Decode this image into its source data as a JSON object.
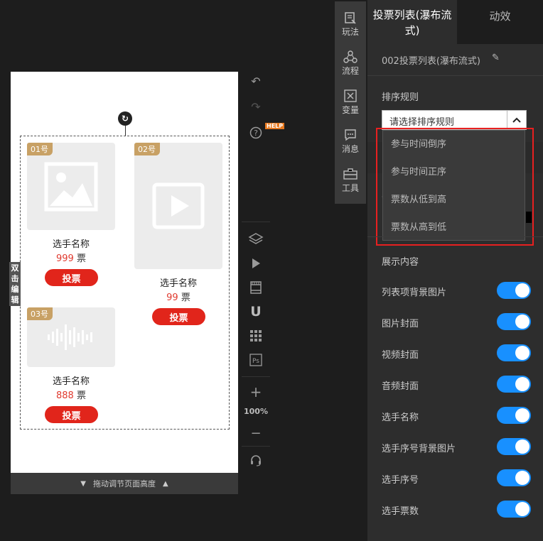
{
  "canvas": {
    "double_click_edit": "双击编辑",
    "footer_label": "拖动调节页面高度",
    "players": [
      {
        "badge": "01号",
        "name": "选手名称",
        "votes": "999",
        "unit": "票",
        "button": "投票",
        "media": "image"
      },
      {
        "badge": "02号",
        "name": "选手名称",
        "votes": "99",
        "unit": "票",
        "button": "投票",
        "media": "video"
      },
      {
        "badge": "03号",
        "name": "选手名称",
        "votes": "888",
        "unit": "票",
        "button": "投票",
        "media": "audio"
      }
    ]
  },
  "toolbar": {
    "help_tag": "HELP",
    "zoom": "100%",
    "icons": [
      "undo-icon",
      "redo-icon",
      "help-icon",
      "layers-icon",
      "play-icon",
      "film-icon",
      "magnet-icon",
      "grid-icon",
      "ps-icon",
      "zoom-in-icon",
      "zoom-out-icon",
      "headset-icon"
    ]
  },
  "side_tools": [
    {
      "label": "玩法",
      "icon": "gameplay-icon"
    },
    {
      "label": "流程",
      "icon": "flow-icon"
    },
    {
      "label": "变量",
      "icon": "variable-icon"
    },
    {
      "label": "消息",
      "icon": "message-icon"
    },
    {
      "label": "工具",
      "icon": "toolbox-icon"
    }
  ],
  "panel": {
    "tab_active": "投票列表(瀑布流式)",
    "tab_inactive": "动效",
    "component_title": "002投票列表(瀑布流式)",
    "sort_label": "排序规则",
    "sort_placeholder": "请选择排序规则",
    "sort_options": [
      "参与时间倒序",
      "参与时间正序",
      "票数从低到高",
      "票数从高到低"
    ],
    "show_label": "展示内容",
    "toggles": [
      {
        "label": "列表项背景图片",
        "on": true
      },
      {
        "label": "图片封面",
        "on": true
      },
      {
        "label": "视频封面",
        "on": true
      },
      {
        "label": "音频封面",
        "on": true
      },
      {
        "label": "选手名称",
        "on": true
      },
      {
        "label": "选手序号背景图片",
        "on": true
      },
      {
        "label": "选手序号",
        "on": true
      },
      {
        "label": "选手票数",
        "on": true
      }
    ],
    "colors": {
      "toggle_on": "#1890ff",
      "highlight": "#e82020",
      "vote_button": "#e1251b",
      "badge": "#c8a165"
    }
  }
}
